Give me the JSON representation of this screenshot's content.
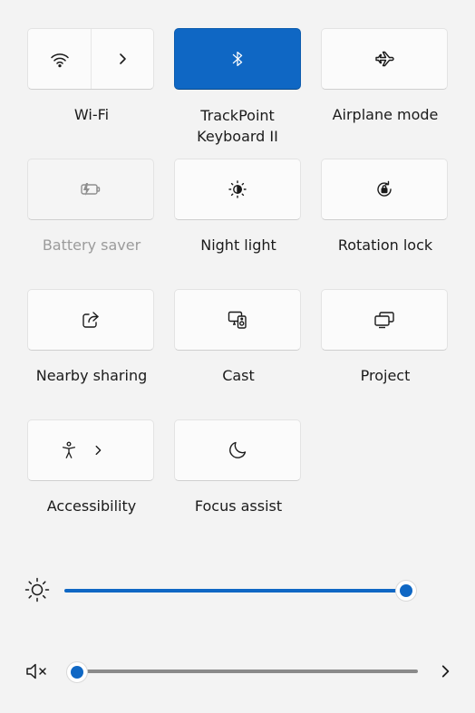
{
  "tiles": [
    {
      "label": "Wi-Fi",
      "icon": "wifi-icon",
      "secondary_icon": "chevron-right-icon",
      "state": "off"
    },
    {
      "label": "TrackPoint Keyboard II",
      "icon": "bluetooth-icon",
      "state": "on"
    },
    {
      "label": "Airplane mode",
      "icon": "airplane-icon",
      "state": "off"
    },
    {
      "label": "Battery saver",
      "icon": "battery-saver-icon",
      "state": "disabled"
    },
    {
      "label": "Night light",
      "icon": "night-light-icon",
      "state": "off"
    },
    {
      "label": "Rotation lock",
      "icon": "rotation-lock-icon",
      "state": "off"
    },
    {
      "label": "Nearby sharing",
      "icon": "share-icon",
      "state": "off"
    },
    {
      "label": "Cast",
      "icon": "cast-icon",
      "state": "off"
    },
    {
      "label": "Project",
      "icon": "project-icon",
      "state": "off"
    },
    {
      "label": "Accessibility",
      "icon": "accessibility-icon",
      "secondary_icon": "chevron-right-icon",
      "state": "off"
    },
    {
      "label": "Focus assist",
      "icon": "moon-icon",
      "state": "off"
    }
  ],
  "brightness": {
    "icon": "sun-icon",
    "level_percent": 100
  },
  "volume": {
    "icon": "speaker-muted-icon",
    "level_percent": 0,
    "muted": true,
    "more_icon": "chevron-right-icon"
  },
  "colors": {
    "accent": "#0f67c4",
    "track_off": "#8a8a8a"
  }
}
